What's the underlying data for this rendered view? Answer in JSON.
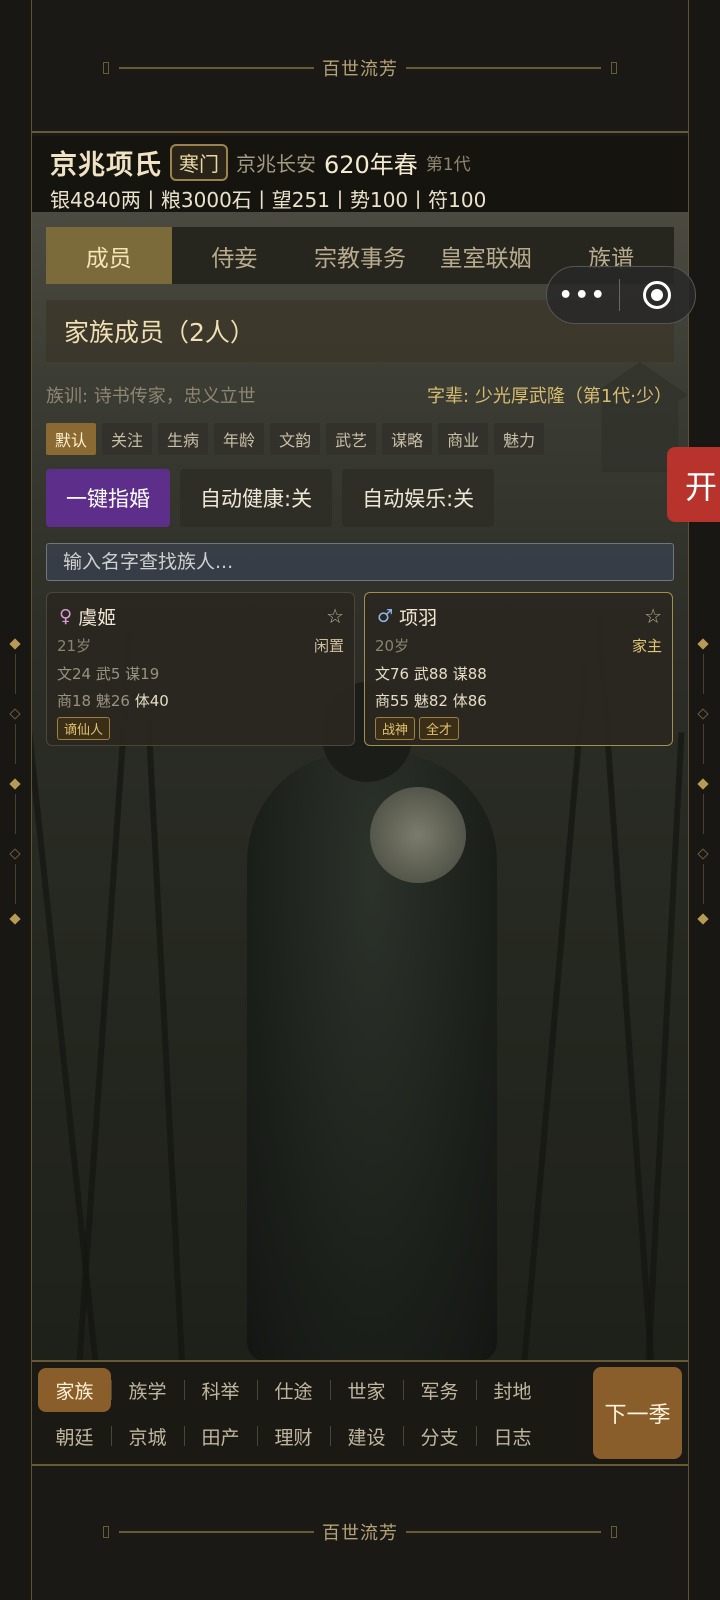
{
  "banner": {
    "title": "百世流芳"
  },
  "header": {
    "clan_name": "京兆项氏",
    "rank": "寒门",
    "location": "京兆长安",
    "year": "620年春",
    "generation": "第1代",
    "resources": "银4840两丨粮3000石丨望251丨势100丨符100"
  },
  "tabs": [
    {
      "label": "成员",
      "active": true
    },
    {
      "label": "侍妾",
      "active": false
    },
    {
      "label": "宗教事务",
      "active": false
    },
    {
      "label": "皇室联姻",
      "active": false
    },
    {
      "label": "族谱",
      "active": false
    }
  ],
  "capsule": {
    "more": "•••"
  },
  "side_button": {
    "label": "开"
  },
  "members": {
    "title": "家族成员（2人）",
    "motto": "族训: 诗书传家，忠义立世",
    "zibei": "字辈: 少光厚武隆（第1代·少）"
  },
  "filters": [
    "默认",
    "关注",
    "生病",
    "年龄",
    "文韵",
    "武艺",
    "谋略",
    "商业",
    "魅力"
  ],
  "actions": {
    "marry": "一键指婚",
    "auto_health": "自动健康:关",
    "auto_fun": "自动娱乐:关"
  },
  "search": {
    "placeholder": "输入名字查找族人..."
  },
  "cards": [
    {
      "sex": "♀",
      "name": "虞姬",
      "star": "☆",
      "age": "21岁",
      "status": "闲置",
      "stats1": "文24 武5 谋19",
      "stats2_a": "商18 魅26 ",
      "stats2_b": "体40",
      "tags": [
        "谪仙人"
      ]
    },
    {
      "sex": "♂",
      "name": "项羽",
      "star": "☆",
      "age": "20岁",
      "status": "家主",
      "stats1": "文76 武88 谋88",
      "stats2_a": "商55 魅82 ",
      "stats2_b": "体86",
      "tags": [
        "战神",
        "全才"
      ]
    }
  ],
  "nav": {
    "row1": [
      "家族",
      "族学",
      "科举",
      "仕途",
      "世家",
      "军务",
      "封地"
    ],
    "row2": [
      "朝廷",
      "京城",
      "田产",
      "理财",
      "建设",
      "分支",
      "日志"
    ],
    "next": "下一季"
  }
}
